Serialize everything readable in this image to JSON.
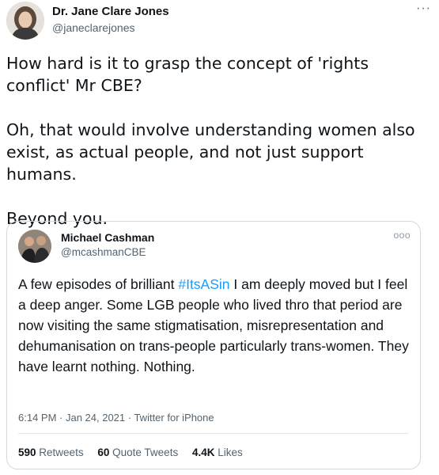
{
  "tweet": {
    "author_name": "Dr. Jane Clare Jones",
    "author_handle": "@janeclarejones",
    "more_label": "···",
    "paragraphs": [
      "How hard is it to grasp the concept of 'rights conflict' Mr CBE?",
      "Oh, that would involve understanding women also exist, as actual people, and not just support humans.",
      "Beyond you."
    ]
  },
  "quoted": {
    "author_name": "Michael Cashman",
    "author_handle": "@mcashmanCBE",
    "more_label": "ooo",
    "text_before": "A few episodes of brilliant ",
    "hashtag": "#ItsASin",
    "text_after": " I am deeply moved but I feel a deep anger. Some LGB people who lived thro that period are now visiting the same stigmatisation, misrepresentation and dehumanisation on trans-people particularly trans-women.  They have learnt nothing. Nothing.",
    "meta": "6:14 PM · Jan 24, 2021 · Twitter for iPhone",
    "stats": {
      "retweets_count": "590",
      "retweets_label": "Retweets",
      "quotes_count": "60",
      "quotes_label": "Quote Tweets",
      "likes_count": "4.4K",
      "likes_label": "Likes"
    }
  },
  "colors": {
    "link": "#1d9bf0",
    "secondary_text": "#536471",
    "border": "#cfd9de"
  }
}
